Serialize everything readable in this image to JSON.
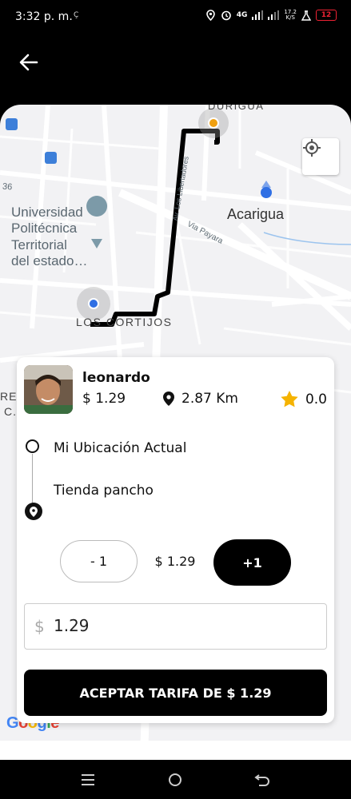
{
  "status_bar": {
    "time": "3:32 p. m.",
    "carrier_icon": "Ç",
    "network": "4G",
    "net_rate_value": "17.2",
    "net_rate_unit": "K/S",
    "battery": "12",
    "battery_color": "#e23333"
  },
  "header": {
    "back_icon": "arrow-left-icon"
  },
  "map": {
    "labels": {
      "university_line1": "Universidad",
      "university_line2": "Politécnica",
      "university_line3": "Territorial",
      "university_line4": "del estado…",
      "city": "Acarigua",
      "neighborhood": "LOS CORTIJOS",
      "top_area": "DURIGUA",
      "street_av": "Av. Los Libertadores",
      "street_payara": "Via Payara",
      "street_36": "36",
      "edge_left_1": "RE",
      "edge_left_2": "C."
    },
    "google": {
      "letters": [
        "G",
        "o",
        "o",
        "g",
        "l",
        "e"
      ],
      "colors": [
        "#4285F4",
        "#EA4335",
        "#FBBC05",
        "#4285F4",
        "#34A853",
        "#EA4335"
      ]
    },
    "route_color": "#000000",
    "origin_color": "#2f6fe4",
    "destination_color": "#f0a010"
  },
  "trip_card": {
    "driver_name": "leonardo",
    "price": "$ 1.29",
    "distance": "2.87 Km",
    "rating": "0.0",
    "rating_color": "#f5b301",
    "origin": "Mi Ubicación Actual",
    "destination": "Tienda pancho",
    "decrement_label": "- 1",
    "current_fare": "$ 1.29",
    "increment_label": "+1",
    "fare_input": {
      "currency": "$",
      "value": "1.29"
    },
    "accept_label": "ACEPTAR TARIFA DE $ 1.29"
  }
}
